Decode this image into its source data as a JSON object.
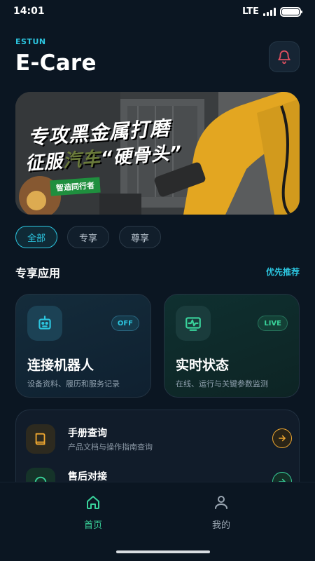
{
  "status_bar": {
    "time": "14:01",
    "network": "LTE"
  },
  "header": {
    "brand": "ESTUN",
    "title": "E-Care",
    "bell_icon": "bell-icon"
  },
  "banner": {
    "line1": "专攻黑金属打磨",
    "line2_prefix": "征服",
    "line2_highlight": "汽车",
    "line2_suffix": "“硬骨头”",
    "tag": "智造同行者"
  },
  "chips": [
    {
      "label": "全部",
      "active": true
    },
    {
      "label": "专享",
      "active": false
    },
    {
      "label": "尊享",
      "active": false
    }
  ],
  "section": {
    "title": "专享应用",
    "link": "优先推荐"
  },
  "cards": [
    {
      "title": "连接机器人",
      "subtitle": "设备资料、履历和服务记录",
      "badge": "OFF",
      "icon": "robot-icon",
      "accent": "#2cc6e0"
    },
    {
      "title": "实时状态",
      "subtitle": "在线、运行与关键参数监测",
      "badge": "LIVE",
      "icon": "pulse-monitor-icon",
      "accent": "#39d39b"
    }
  ],
  "list": [
    {
      "title": "手册查询",
      "subtitle": "产品文档与操作指南查询",
      "icon": "book-icon",
      "accent": "#f0a830"
    },
    {
      "title": "售后对接",
      "subtitle": "",
      "icon": "headset-icon",
      "accent": "#39d39b"
    }
  ],
  "tabbar": [
    {
      "label": "首页",
      "icon": "home-icon",
      "active": true
    },
    {
      "label": "我的",
      "icon": "user-icon",
      "active": false
    }
  ],
  "colors": {
    "background": "#0b1622",
    "accent_cyan": "#2cc6e0",
    "accent_green": "#39d39b",
    "alert_red": "#e05060"
  }
}
